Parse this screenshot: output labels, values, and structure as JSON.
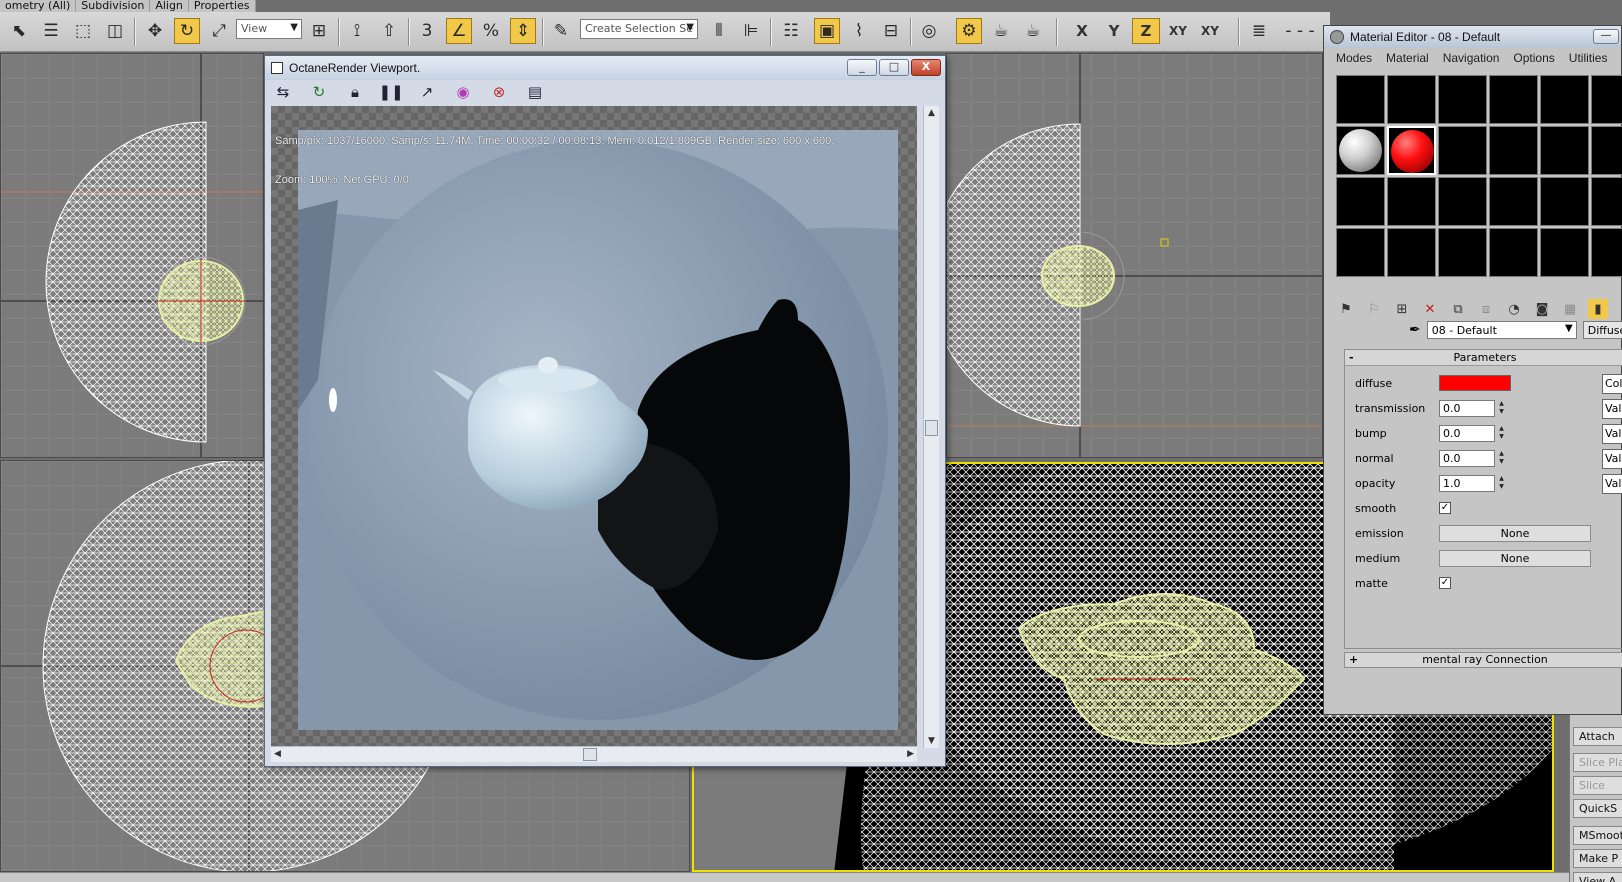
{
  "ribbon_tabs": [
    "ometry (All)",
    "Subdivision",
    "Align",
    "Properties"
  ],
  "toolbar": {
    "reference_coord": "View",
    "named_selection_placeholder": "Create Selection Se",
    "spinner_snap_label": "3",
    "percent_label": "%",
    "axis_constraints": [
      "X",
      "Y",
      "Z",
      "XY",
      "XY"
    ]
  },
  "octane": {
    "title": "OctaneRender Viewport.",
    "window_buttons": [
      "_",
      "□",
      "X"
    ],
    "stats_line1": "Samp/pix: 1037/16000.   Samp/s: 11.74M.   Time: 00:00:32 / 00:08:13.   Mem: 0.012/1.809GB.   Render size: 600 x 600.",
    "stats_line2": "Zoom: 100%.   Net GPU: 0/0",
    "toolbar_icons": [
      "send-scene-icon",
      "restart-icon",
      "lock-icon",
      "pause-icon",
      "focus-picker-icon",
      "color-picker-icon",
      "material-picker-icon",
      "settings-icon"
    ]
  },
  "material_editor": {
    "title": "Material Editor - 08 - Default",
    "menu": [
      "Modes",
      "Material",
      "Navigation",
      "Options",
      "Utilities"
    ],
    "material_name": "08 - Default",
    "material_type": "Diffuse",
    "rollout_title": "Parameters",
    "rollout_toggle": "-",
    "params": {
      "diffuse_label": "diffuse",
      "diffuse_color": "#ff0000",
      "transmission_label": "transmission",
      "transmission_value": "0.0",
      "bump_label": "bump",
      "bump_value": "0.0",
      "normal_label": "normal",
      "normal_value": "0.0",
      "opacity_label": "opacity",
      "opacity_value": "1.0",
      "smooth_label": "smooth",
      "smooth_checked": "✓",
      "emission_label": "emission",
      "emission_value": "None",
      "medium_label": "medium",
      "medium_value": "None",
      "matte_label": "matte",
      "matte_checked": "✓"
    },
    "side_buttons": [
      "Col",
      "Valu",
      "Valu",
      "Valu",
      "Valu"
    ],
    "second_rollout": "mental ray Connection",
    "second_rollout_toggle": "+"
  },
  "command_panel": [
    "Attach",
    "Slice Pla",
    "Slice",
    "QuickS",
    "MSmoot",
    "Make P",
    "View A"
  ],
  "colors": {
    "viewport_bg": "#7b7b7b",
    "active_viewport_border": "#f0e000",
    "wire_white": "#ffffff",
    "teapot_wire": "#e6efa6",
    "accent_toolbar": "#f2c84a"
  }
}
